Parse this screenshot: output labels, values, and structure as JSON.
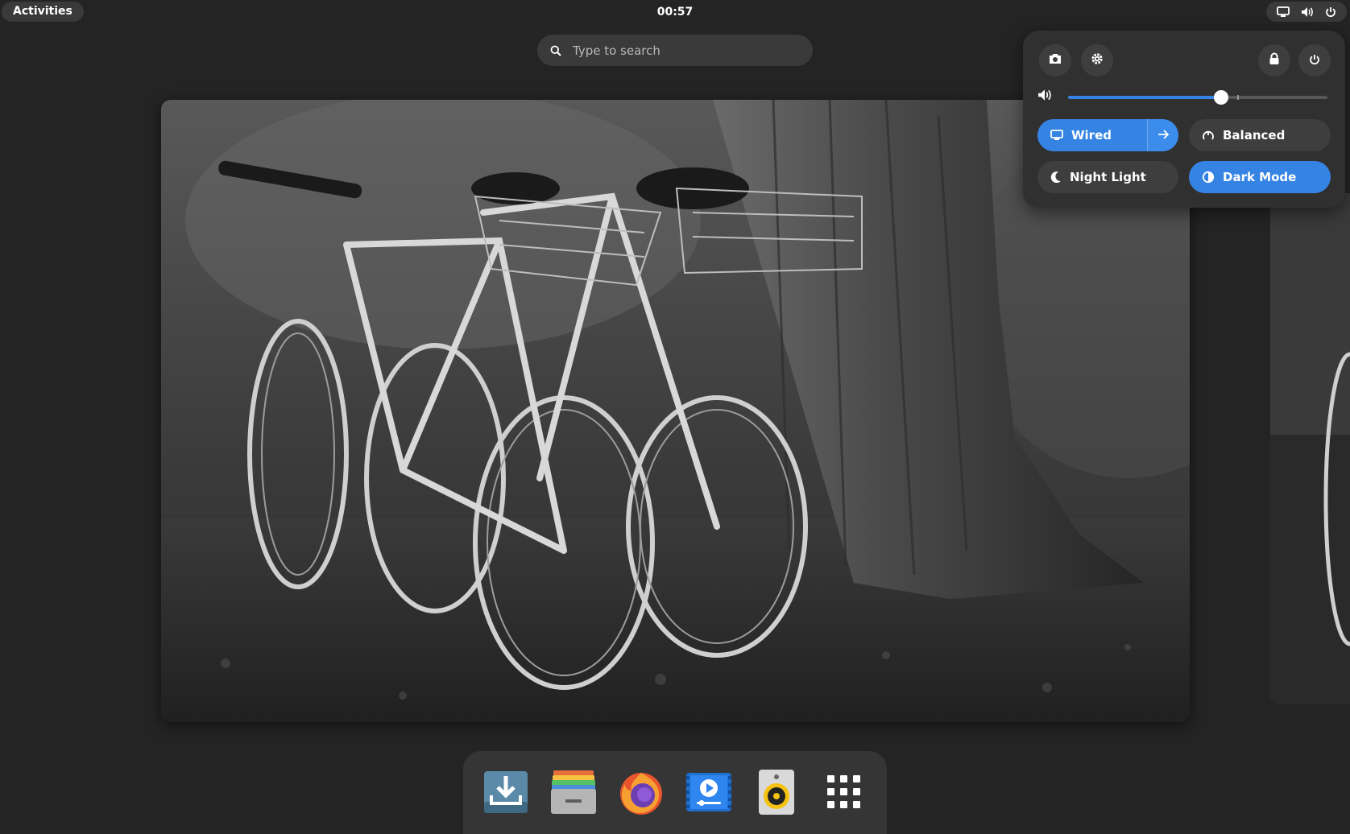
{
  "topbar": {
    "activities_label": "Activities",
    "clock": "00:57",
    "tray_icons": [
      "network-wired-icon",
      "volume-icon",
      "power-icon"
    ]
  },
  "search": {
    "placeholder": "Type to search",
    "icon": "search-icon"
  },
  "workspace": {
    "wallpaper": "black-and-white photo of bicycles leaning against a tree"
  },
  "quick_settings": {
    "top_buttons": [
      "screenshot-icon",
      "settings-icon",
      "lock-icon",
      "power-icon"
    ],
    "volume": {
      "icon": "volume-icon",
      "level": 0.59
    },
    "toggles": [
      {
        "label": "Wired",
        "active": true,
        "icon": "network-wired-icon",
        "has_arrow": true
      },
      {
        "label": "Balanced",
        "active": false,
        "icon": "power-profile-icon"
      },
      {
        "label": "Night Light",
        "active": false,
        "icon": "night-light-icon"
      },
      {
        "label": "Dark Mode",
        "active": true,
        "icon": "dark-mode-icon"
      }
    ],
    "accent_color": "#3584e4"
  },
  "dock": {
    "apps": [
      {
        "name": "download-app-icon"
      },
      {
        "name": "files-app-icon"
      },
      {
        "name": "firefox-app-icon"
      },
      {
        "name": "video-player-app-icon"
      },
      {
        "name": "speaker-app-icon"
      },
      {
        "name": "show-apps-icon"
      }
    ]
  }
}
